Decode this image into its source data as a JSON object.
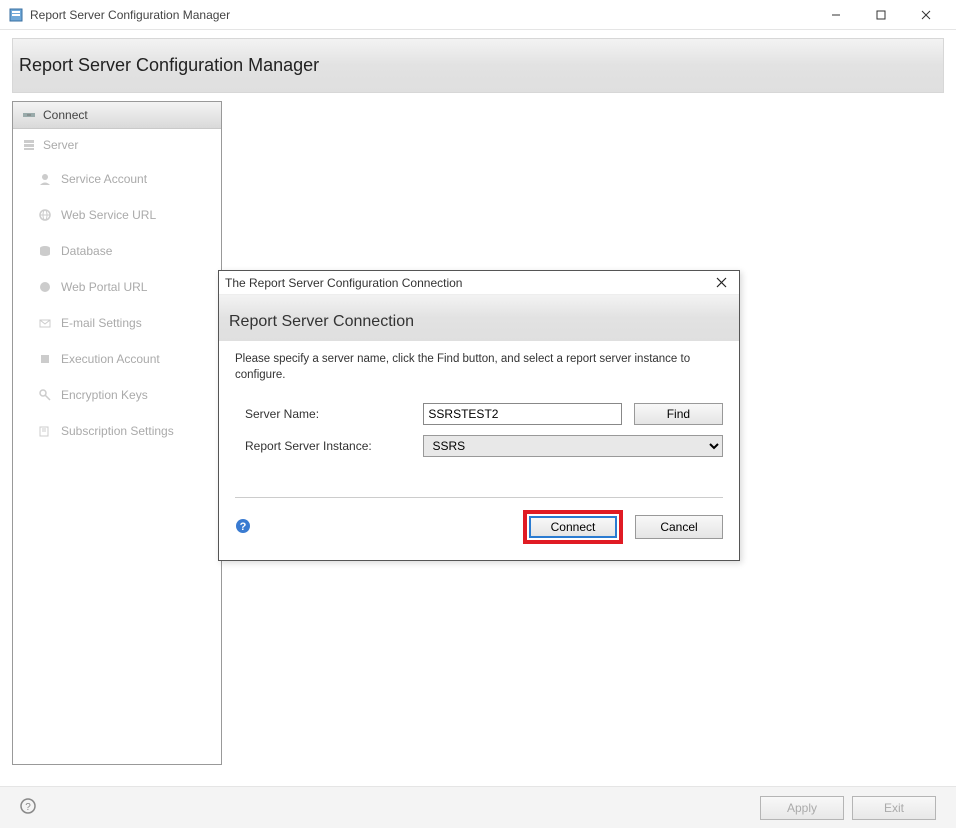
{
  "window": {
    "title": "Report Server Configuration Manager"
  },
  "header": {
    "title": "Report Server Configuration Manager"
  },
  "sidebar": {
    "connect_label": "Connect",
    "server_label": "Server",
    "items": [
      {
        "label": "Service Account"
      },
      {
        "label": "Web Service URL"
      },
      {
        "label": "Database"
      },
      {
        "label": "Web Portal URL"
      },
      {
        "label": "E-mail Settings"
      },
      {
        "label": "Execution Account"
      },
      {
        "label": "Encryption Keys"
      },
      {
        "label": "Subscription Settings"
      }
    ]
  },
  "footer": {
    "apply_label": "Apply",
    "exit_label": "Exit"
  },
  "dialog": {
    "titlebar": "The Report Server Configuration Connection",
    "header": "Report Server Connection",
    "instruction": "Please specify a server name, click the Find button, and select a report server instance to configure.",
    "server_name_label": "Server Name:",
    "server_name_value": "SSRSTEST2",
    "instance_label": "Report Server Instance:",
    "instance_value": "SSRS",
    "find_label": "Find",
    "connect_label": "Connect",
    "cancel_label": "Cancel"
  }
}
